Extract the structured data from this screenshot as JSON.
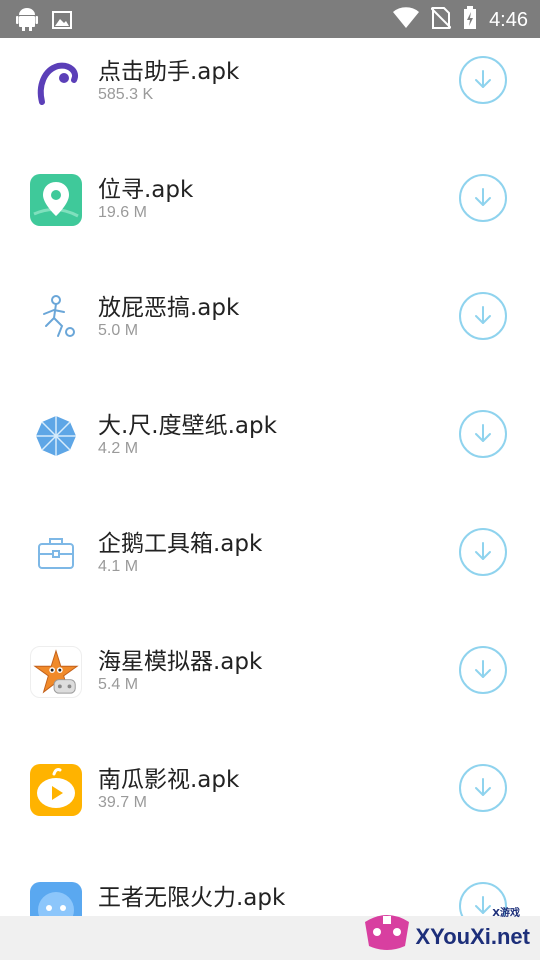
{
  "status_bar": {
    "time": "4:46",
    "left_icons": [
      "android-icon",
      "image-icon"
    ],
    "right_icons": [
      "wifi-icon",
      "no-sim-icon",
      "battery-charging-icon"
    ]
  },
  "apps": [
    {
      "name": "点击助手.apk",
      "size": "585.3 K",
      "icon": "click-helper-icon"
    },
    {
      "name": "位寻.apk",
      "size": "19.6 M",
      "icon": "location-pin-icon"
    },
    {
      "name": "放屁恶搞.apk",
      "size": "5.0 M",
      "icon": "prank-figure-icon"
    },
    {
      "name": "大.尺.度壁纸.apk",
      "size": "4.2 M",
      "icon": "umbrella-icon"
    },
    {
      "name": "企鹅工具箱.apk",
      "size": "4.1 M",
      "icon": "toolbox-icon"
    },
    {
      "name": "海星模拟器.apk",
      "size": "5.4 M",
      "icon": "starfish-icon"
    },
    {
      "name": "南瓜影视.apk",
      "size": "39.7 M",
      "icon": "play-icon"
    },
    {
      "name": "王者无限火力.apk",
      "size": "",
      "icon": "game-face-icon"
    }
  ],
  "watermark": {
    "text": "XYouXi.net",
    "small": "X游戏"
  },
  "colors": {
    "accent": "#8fd3ee",
    "status_bar": "#7d7d7d"
  }
}
